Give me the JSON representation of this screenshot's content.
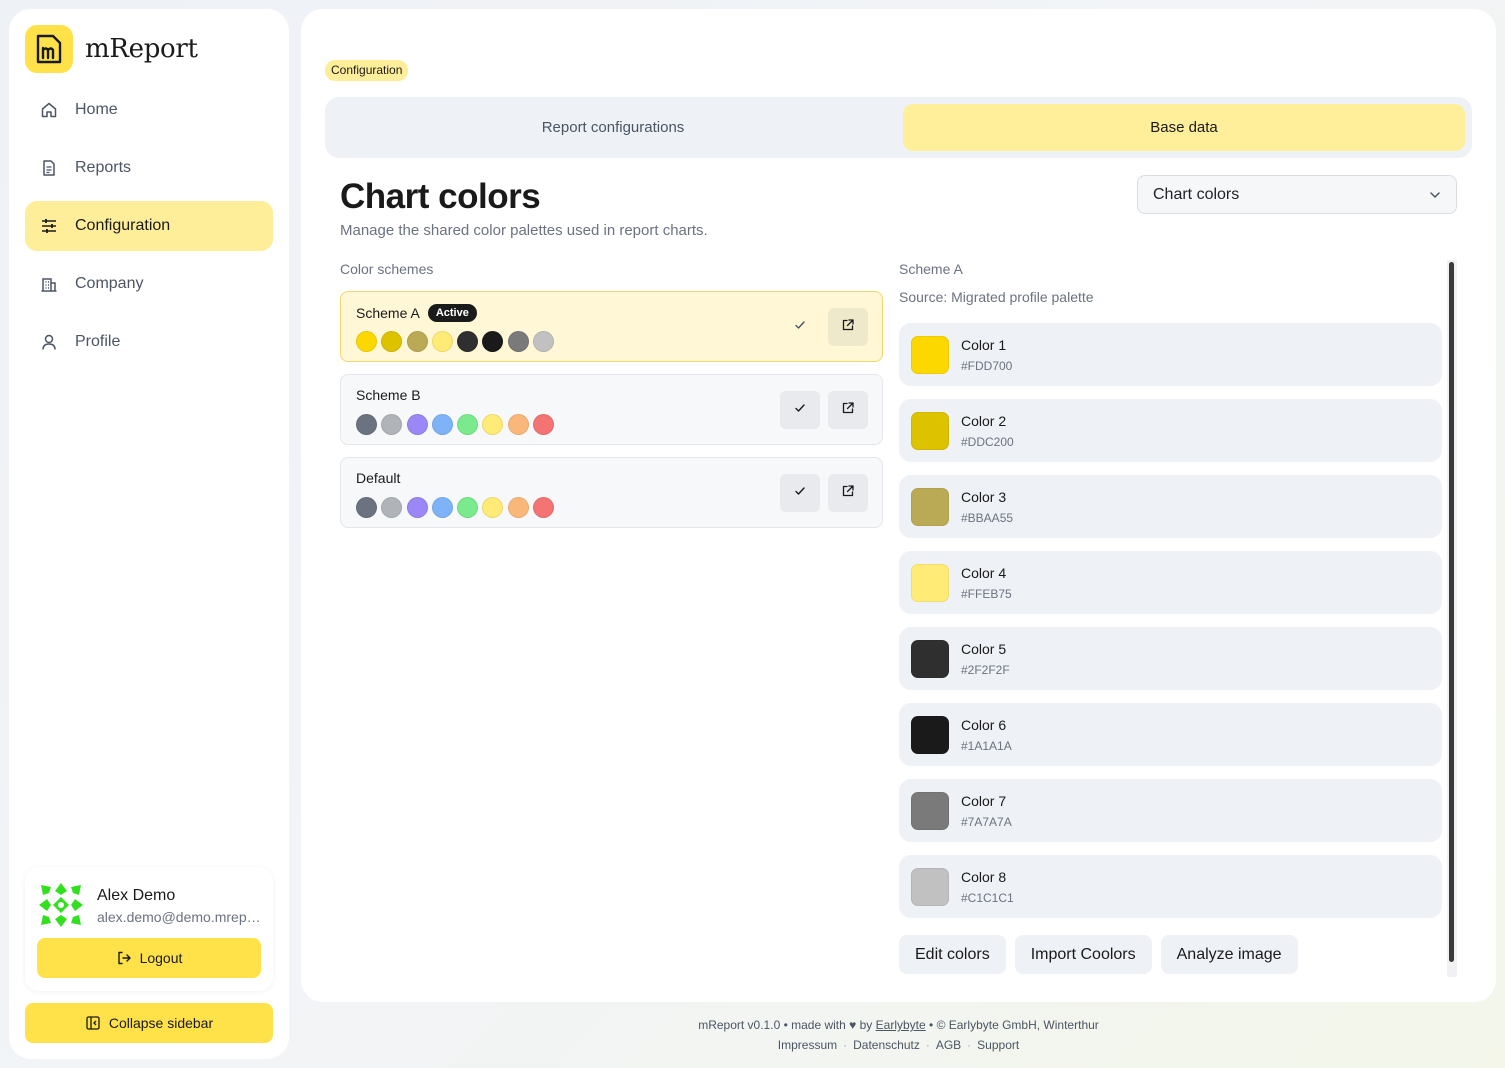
{
  "app": {
    "name": "mReport"
  },
  "nav": [
    {
      "label": "Home",
      "icon": "home-icon"
    },
    {
      "label": "Reports",
      "icon": "document-icon"
    },
    {
      "label": "Configuration",
      "icon": "sliders-icon",
      "active": true
    },
    {
      "label": "Company",
      "icon": "building-icon"
    },
    {
      "label": "Profile",
      "icon": "user-icon"
    }
  ],
  "user": {
    "name": "Alex Demo",
    "email": "alex.demo@demo.mreport.ch"
  },
  "logout_label": "Logout",
  "collapse_label": "Collapse sidebar",
  "breadcrumb": "Configuration",
  "tabs": [
    {
      "label": "Report configurations",
      "active": false
    },
    {
      "label": "Base data",
      "active": true
    }
  ],
  "page": {
    "title": "Chart colors",
    "subtitle": "Manage the shared color palettes used in report charts."
  },
  "select": {
    "value": "Chart colors"
  },
  "schemes_label": "Color schemes",
  "schemes": [
    {
      "name": "Scheme A",
      "badge": "Active",
      "active": true,
      "swatches": [
        "#FDD700",
        "#DDC200",
        "#BBAA55",
        "#FFEB75",
        "#2F2F2F",
        "#1A1A1A",
        "#7A7A7A",
        "#C1C1C1"
      ]
    },
    {
      "name": "Scheme B",
      "active": false,
      "swatches": [
        "#6B7280",
        "#B0B3B8",
        "#9B87F5",
        "#7EB3F7",
        "#7BEA8C",
        "#FFEB75",
        "#F9B87A",
        "#F47474"
      ]
    },
    {
      "name": "Default",
      "active": false,
      "swatches": [
        "#6B7280",
        "#B0B3B8",
        "#9B87F5",
        "#7EB3F7",
        "#7BEA8C",
        "#FFEB75",
        "#F9B87A",
        "#F47474"
      ]
    }
  ],
  "detail": {
    "title": "Scheme A",
    "source": "Source: Migrated profile palette",
    "colors": [
      {
        "name": "Color 1",
        "hex": "#FDD700"
      },
      {
        "name": "Color 2",
        "hex": "#DDC200"
      },
      {
        "name": "Color 3",
        "hex": "#BBAA55"
      },
      {
        "name": "Color 4",
        "hex": "#FFEB75"
      },
      {
        "name": "Color 5",
        "hex": "#2F2F2F"
      },
      {
        "name": "Color 6",
        "hex": "#1A1A1A"
      },
      {
        "name": "Color 7",
        "hex": "#7A7A7A"
      },
      {
        "name": "Color 8",
        "hex": "#C1C1C1"
      }
    ]
  },
  "actions": [
    "Edit colors",
    "Import Coolors",
    "Analyze image"
  ],
  "footer": {
    "line1_pre": "mReport v0.1.0 • made with",
    "heart": "♥",
    "by": "by",
    "link": "Earlybyte",
    "line1_post": "• © Earlybyte GmbH, Winterthur",
    "links": [
      "Impressum",
      "Datenschutz",
      "AGB",
      "Support"
    ]
  },
  "colors": {
    "accent": "#FFE24A",
    "active_bg": "#FFEE99",
    "active_card": "#FFF7D6"
  }
}
